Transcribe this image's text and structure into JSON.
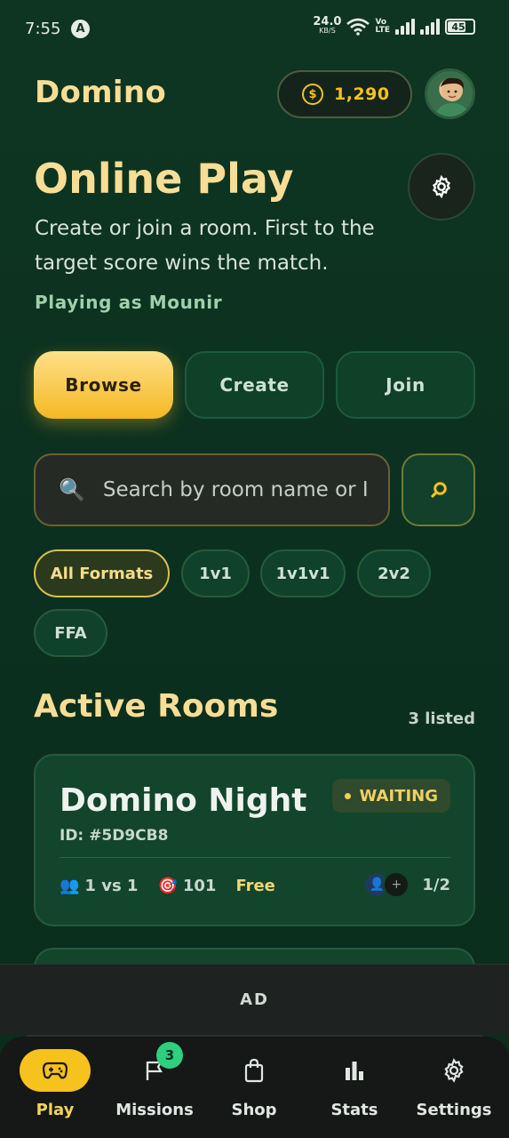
{
  "status_bar": {
    "time": "7:55",
    "net_speed": "24.0",
    "net_unit": "KB/S",
    "volte_top": "Vo",
    "volte_bottom": "LTE",
    "battery": "45"
  },
  "header": {
    "app_title": "Domino",
    "coins": "1,290",
    "coin_symbol": "$"
  },
  "hero": {
    "title": "Online Play",
    "subtitle": "Create or join a room. First to the target score wins the match.",
    "playing_as": "Playing as Mounir"
  },
  "segments": {
    "browse": "Browse",
    "create": "Create",
    "join": "Join",
    "selected": "Browse"
  },
  "search": {
    "placeholder": "Search by room name or ID",
    "value": ""
  },
  "filters": {
    "items": [
      "All Formats",
      "1v1",
      "1v1v1",
      "2v2",
      "FFA"
    ],
    "selected": "All Formats"
  },
  "rooms": {
    "section_title": "Active Rooms",
    "count_label": "3 listed",
    "list": [
      {
        "name": "Domino Night",
        "id": "ID: #5D9CB8",
        "status": "WAITING",
        "format": "1 vs 1",
        "target": "101",
        "fee": "Free",
        "players": "1/2"
      }
    ]
  },
  "ad": {
    "label": "AD"
  },
  "nav": {
    "items": [
      {
        "label": "Play",
        "icon": "gamepad-icon"
      },
      {
        "label": "Missions",
        "icon": "flag-icon",
        "badge": "3"
      },
      {
        "label": "Shop",
        "icon": "shopping-bag-icon"
      },
      {
        "label": "Stats",
        "icon": "bar-chart-icon"
      },
      {
        "label": "Settings",
        "icon": "gear-icon"
      }
    ],
    "active": "Play"
  },
  "colors": {
    "accent": "#f6c21d",
    "title": "#f7dd95",
    "background": "#0c3120",
    "card": "#12452c",
    "badge_green": "#2ecf7e"
  }
}
